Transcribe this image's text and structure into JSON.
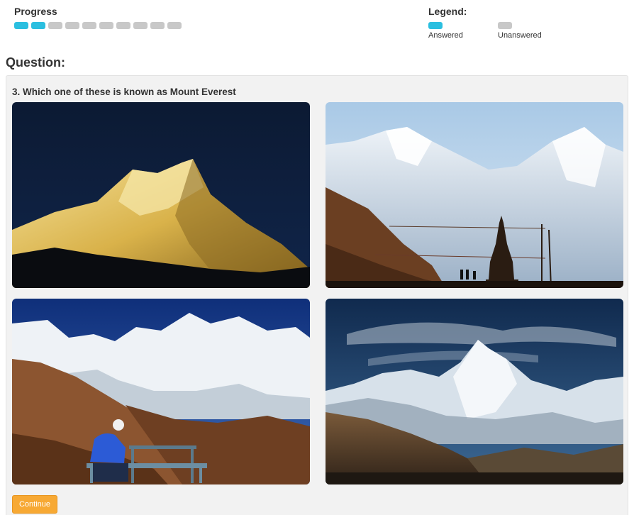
{
  "progress": {
    "label": "Progress",
    "answered_count": 2,
    "total_segments": 10
  },
  "legend": {
    "label": "Legend:",
    "items": [
      {
        "label": "Answered",
        "color": "#2bbfe0"
      },
      {
        "label": "Unanswered",
        "color": "#c8c8c8"
      }
    ]
  },
  "question": {
    "heading": "Question:",
    "text": "3. Which one of these is known as Mount Everest",
    "options": [
      {
        "image": "golden-peak-night-photo"
      },
      {
        "image": "everest-stupa-prayer-flags-photo"
      },
      {
        "image": "hiker-bench-snow-range-photo"
      },
      {
        "image": "ama-dablam-peak-photo"
      }
    ]
  },
  "continue_label": "Continue",
  "colors": {
    "accent": "#2bbfe0",
    "unanswered": "#c8c8c8",
    "button": "#f7a934"
  }
}
